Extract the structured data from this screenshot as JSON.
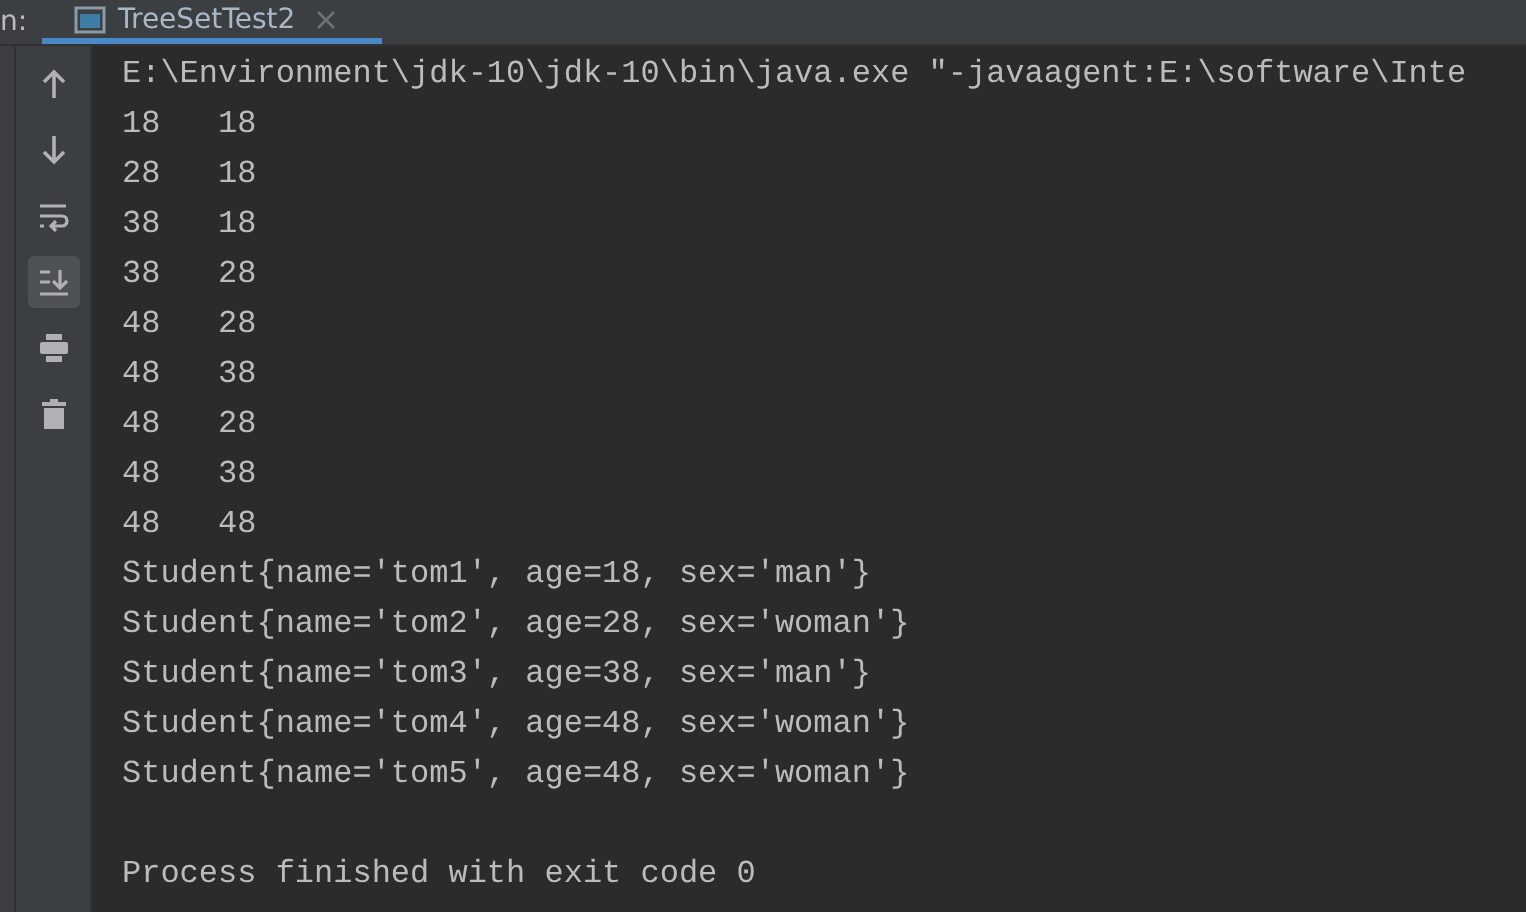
{
  "panel_label": "n:",
  "tabs": [
    {
      "label": "TreeSetTest2",
      "selected": true
    }
  ],
  "toolbar": [
    {
      "kind": "up",
      "selected": false
    },
    {
      "kind": "down",
      "selected": false
    },
    {
      "kind": "wrap",
      "selected": false
    },
    {
      "kind": "scroll-end",
      "selected": true
    },
    {
      "kind": "print",
      "selected": false
    },
    {
      "kind": "trash",
      "selected": false
    }
  ],
  "console_lines": [
    "E:\\Environment\\jdk-10\\jdk-10\\bin\\java.exe \"-javaagent:E:\\software\\Inte",
    "18   18",
    "28   18",
    "38   18",
    "38   28",
    "48   28",
    "48   38",
    "48   28",
    "48   38",
    "48   48",
    "Student{name='tom1', age=18, sex='man'}",
    "Student{name='tom2', age=28, sex='woman'}",
    "Student{name='tom3', age=38, sex='man'}",
    "Student{name='tom4', age=48, sex='woman'}",
    "Student{name='tom5', age=48, sex='woman'}"
  ],
  "exit_message": "Process finished with exit code 0"
}
